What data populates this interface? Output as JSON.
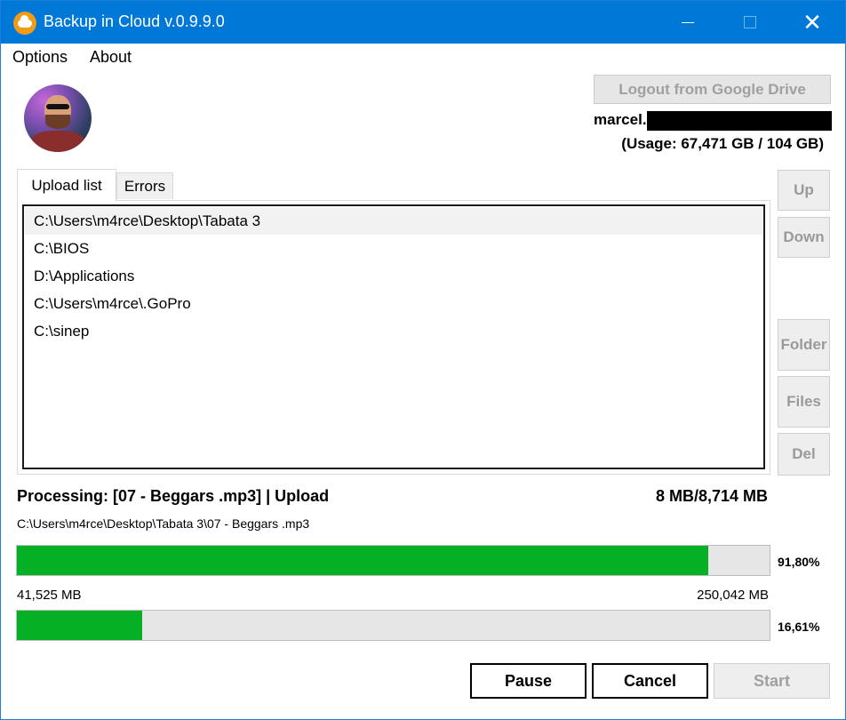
{
  "window": {
    "title": "Backup in Cloud v.0.9.9.0",
    "accent_color": "#0078d7",
    "icon": "cloud-app-icon",
    "controls": {
      "minimize": "",
      "maximize": "",
      "close": "✕"
    }
  },
  "menu": {
    "options": "Options",
    "about": "About"
  },
  "account": {
    "avatar": "user-avatar",
    "logout_label": "Logout from Google Drive",
    "email_visible": "marcel.",
    "usage": "(Usage: 67,471 GB / 104 GB)"
  },
  "tabs": [
    {
      "label": "Upload list",
      "selected": true
    },
    {
      "label": "Errors",
      "selected": false
    }
  ],
  "upload_list": [
    {
      "path": "C:\\Users\\m4rce\\Desktop\\Tabata 3",
      "selected": true
    },
    {
      "path": "C:\\BIOS",
      "selected": false
    },
    {
      "path": "D:\\Applications",
      "selected": false
    },
    {
      "path": "C:\\Users\\m4rce\\.GoPro",
      "selected": false
    },
    {
      "path": "C:\\sinep",
      "selected": false
    }
  ],
  "side_buttons": {
    "up": "Up",
    "down": "Down",
    "folder": "Folder",
    "files": "Files",
    "del": "Del"
  },
  "processing": {
    "status": "Processing: [07 - Beggars .mp3] | Upload",
    "size": "8 MB/8,714 MB",
    "file_path": "C:\\Users\\m4rce\\Desktop\\Tabata 3\\07 - Beggars .mp3",
    "file_progress_percent": 91.8,
    "file_progress_label": "91,80%",
    "total_done": "41,525 MB",
    "total_size": "250,042 MB",
    "total_progress_percent": 16.61,
    "total_progress_label": "16,61%",
    "progress_color": "#06b025"
  },
  "actions": {
    "pause": "Pause",
    "cancel": "Cancel",
    "start": "Start"
  }
}
